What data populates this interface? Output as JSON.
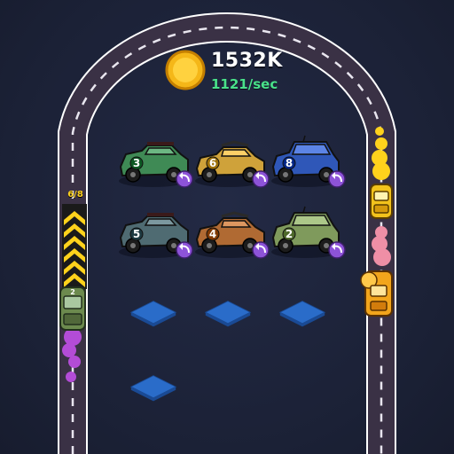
{
  "hud": {
    "coin_total": "1532K",
    "coin_rate": "1121/sec"
  },
  "track": {
    "lane_counter": "6/8"
  },
  "garage": {
    "cars": [
      {
        "model": "buggy",
        "level": "3",
        "color": "#3f8a55",
        "action_icon": "undo-arrow-icon"
      },
      {
        "model": "convertible",
        "level": "6",
        "color": "#cfa23a",
        "action_icon": "undo-arrow-icon"
      },
      {
        "model": "mini",
        "level": "8",
        "color": "#2f57b8",
        "action_icon": "undo-arrow-icon"
      },
      {
        "model": "buggy",
        "level": "5",
        "color": "#4f6b72",
        "action_icon": "undo-arrow-icon"
      },
      {
        "model": "convertible",
        "level": "4",
        "color": "#b06a33",
        "action_icon": "undo-arrow-icon"
      },
      {
        "model": "mini",
        "level": "2",
        "color": "#7f9a5c",
        "action_icon": "undo-arrow-icon"
      }
    ],
    "empty_slots": 4
  },
  "track_cars": [
    {
      "level": "2",
      "color": "#6c8a4e",
      "exhaust_color": "#b34cd6"
    },
    {
      "level": "",
      "color": "#f2c21c",
      "exhaust_color": "#ffd21c"
    },
    {
      "level": "",
      "color": "#f2a51c",
      "exhaust_color": "#ef8fa6"
    }
  ],
  "colors": {
    "road": "#3a3145",
    "road_edge": "#ffffff",
    "lane_dash": "#e9e6ef",
    "slot": "#2a6cc9",
    "badge": "#8d53d8",
    "coin": "#f5b718"
  }
}
